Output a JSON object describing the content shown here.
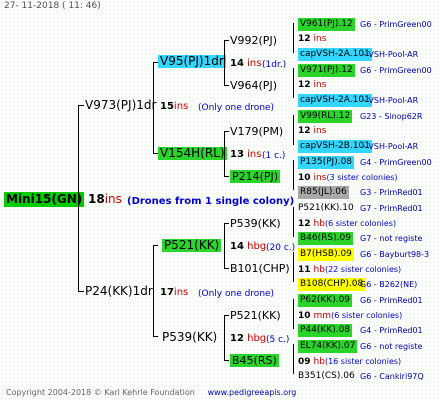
{
  "header": {
    "date": "27-  11-2018  ( 11:  46)"
  },
  "root": {
    "name": "Mini15(GN)",
    "count": "18",
    "unit": "ins",
    "note": "(Drones from 1 single colony)"
  },
  "g1": [
    {
      "name": "V973(PJ)1dr",
      "count": "15",
      "unit": "ins",
      "note": "(Only one drone)"
    },
    {
      "name": "P24(KK)1dr",
      "count": "17",
      "unit": "ins",
      "note": "(Only one drone)"
    }
  ],
  "g2": [
    {
      "name": "V95(PJ)1dr",
      "count": "14",
      "unit": "ins",
      "note": "(1dr.)"
    },
    {
      "name": "V154H(RL)",
      "count": "13",
      "unit": "ins",
      "note": "(1 c.)"
    },
    {
      "name": "P521(KK)",
      "count": "14",
      "unit": "hbg",
      "note": "(20 c.)"
    },
    {
      "name": "P539(KK)",
      "count": "12",
      "unit": "hbg",
      "note": "(5 c.)"
    }
  ],
  "g3": [
    {
      "name": "V992(PJ)",
      "count": "",
      "unit": "",
      "note": ""
    },
    {
      "name": "V964(PJ)",
      "count": "",
      "unit": "",
      "note": ""
    },
    {
      "name": "V179(PM)",
      "count": "",
      "unit": "",
      "note": ""
    },
    {
      "name": "P214(PJ)",
      "count": "",
      "unit": "",
      "note": ""
    },
    {
      "name": "P539(KK)",
      "count": "",
      "unit": "",
      "note": ""
    },
    {
      "name": "B101(CHP)",
      "count": "",
      "unit": "",
      "note": ""
    },
    {
      "name": "P521(KK)",
      "count": "",
      "unit": "",
      "note": ""
    },
    {
      "name": "B45(RS)",
      "count": "",
      "unit": "",
      "note": ""
    }
  ],
  "g4": [
    {
      "name": "V961(PJ).12",
      "src": "G6 - PrimGreen00"
    },
    {
      "count": "12",
      "unit": "ins"
    },
    {
      "name": "capVSH-2A.101",
      "src": "- VSH-Pool-AR"
    },
    {
      "name": "V971(PJ).12",
      "src": "G6 - PrimGreen00"
    },
    {
      "count": "12",
      "unit": "ins"
    },
    {
      "name": "capVSH-2A.101",
      "src": "- VSH-Pool-AR"
    },
    {
      "name": "V99(RL).12",
      "src": "G23 - Sinop62R"
    },
    {
      "count": "12",
      "unit": "ins"
    },
    {
      "name": "capVSH-2B.101",
      "src": "- VSH-Pool-AR"
    },
    {
      "name": "P135(PJ).08",
      "src": "G4 - PrimGreen00"
    },
    {
      "count": "10",
      "unit": "ins",
      "note": "(3 sister colonies)"
    },
    {
      "name": "R85(JL).06",
      "src": "G3 - PrimRed01"
    },
    {
      "name": "P521(KK).10",
      "src": "G7 - PrimRed01"
    },
    {
      "count": "12",
      "unit": "hb",
      "note": "(6 sister colonies)"
    },
    {
      "name": "B46(RS).09",
      "src": "G7 - not registe"
    },
    {
      "name": "B7(HSB).09",
      "src": "G6 - Bayburt98-3"
    },
    {
      "count": "11",
      "unit": "hb",
      "note": "(22 sister colonies)"
    },
    {
      "name": "B108(CHP).08",
      "src": "G6 - B262(NE)"
    },
    {
      "name": "P62(KK).09",
      "src": "G6 - PrimRed01"
    },
    {
      "count": "10",
      "unit": "mm",
      "note": "(6 sister colonies)"
    },
    {
      "name": "P44(KK).08",
      "src": "G4 - PrimRed01"
    },
    {
      "name": "EL74(KK).07",
      "src": "G6 - not registe"
    },
    {
      "count": "09",
      "unit": "hb",
      "note": "(16 sister colonies)"
    },
    {
      "name": "B351(CS).06",
      "src": "G6 - Cankiri97Q"
    }
  ],
  "footer": {
    "copyright": "Copyright 2004-2018 © Karl Kehrle Foundation",
    "site": "www.pedigreeapis.org"
  }
}
